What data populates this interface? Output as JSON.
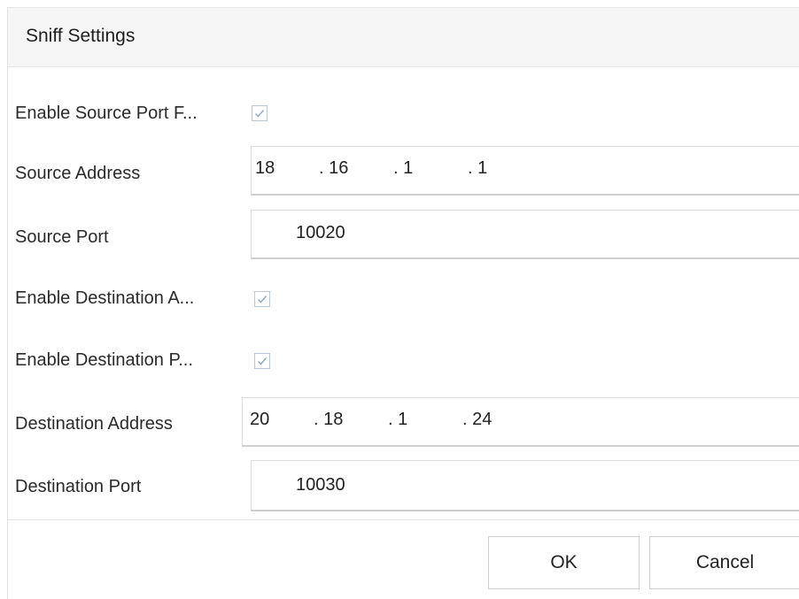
{
  "dialog": {
    "title": "Sniff Settings"
  },
  "form": {
    "enable_source_port_filter": {
      "label": "Enable Source Port F...",
      "checked": true
    },
    "source_address": {
      "label": "Source Address",
      "octets": [
        "18",
        ". 16",
        ". 1",
        ". 1"
      ]
    },
    "source_port": {
      "label": "Source Port",
      "value": "10020"
    },
    "enable_destination_address": {
      "label": "Enable Destination A...",
      "checked": true
    },
    "enable_destination_port": {
      "label": "Enable Destination P...",
      "checked": true
    },
    "destination_address": {
      "label": "Destination Address",
      "octets": [
        "20",
        ". 18",
        ". 1",
        ". 24"
      ]
    },
    "destination_port": {
      "label": "Destination Port",
      "value": "10030"
    }
  },
  "buttons": {
    "ok": "OK",
    "cancel": "Cancel"
  },
  "colors": {
    "checkmark": "#8aa6c8",
    "title_background": "#f5f5f5"
  }
}
